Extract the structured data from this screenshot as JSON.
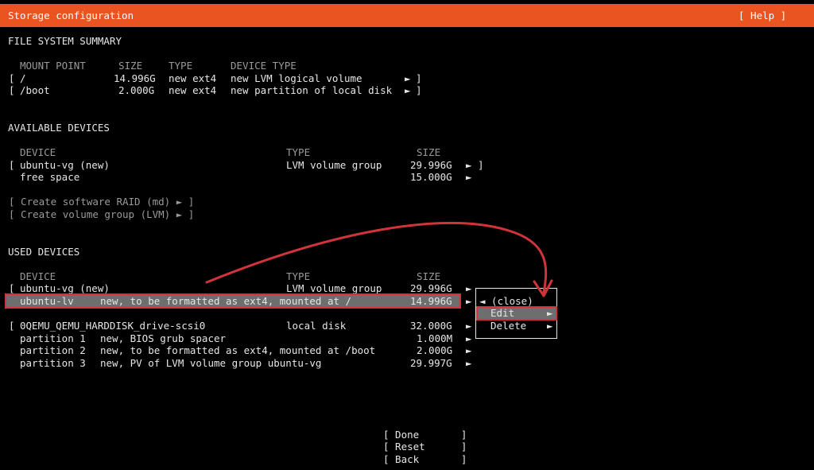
{
  "header": {
    "title": "Storage configuration",
    "help": "[ Help ]"
  },
  "fs_summary": {
    "heading": "FILE SYSTEM SUMMARY",
    "columns": {
      "mount_point": "MOUNT POINT",
      "size": "SIZE",
      "type": "TYPE",
      "device_type": "DEVICE TYPE"
    },
    "rows": [
      {
        "open": "[",
        "mount": "/",
        "size": "14.996G",
        "type": "new ext4",
        "device_type": "new LVM logical volume",
        "arrow": "►",
        "close": "]"
      },
      {
        "open": "[",
        "mount": "/boot",
        "size": "2.000G",
        "type": "new ext4",
        "device_type": "new partition of local disk",
        "arrow": "►",
        "close": "]"
      }
    ]
  },
  "available": {
    "heading": "AVAILABLE DEVICES",
    "columns": {
      "device": "DEVICE",
      "type": "TYPE",
      "size": "SIZE"
    },
    "rows": [
      {
        "open": "[",
        "device": "ubuntu-vg (new)",
        "type": "LVM volume group",
        "size": "29.996G",
        "arrow": "►",
        "close": "]"
      },
      {
        "open": "",
        "device": "free space",
        "type": "",
        "size": "15.000G",
        "arrow": "►",
        "close": ""
      }
    ],
    "actions": [
      "[ Create software RAID (md) ► ]",
      "[ Create volume group (LVM) ► ]"
    ]
  },
  "used": {
    "heading": "USED DEVICES",
    "columns": {
      "device": "DEVICE",
      "type": "TYPE",
      "size": "SIZE"
    },
    "vg": {
      "open": "[",
      "device": "ubuntu-vg (new)",
      "type": "LVM volume group",
      "size": "29.996G",
      "arrow": "►"
    },
    "lv": {
      "device": "ubuntu-lv",
      "desc": "new, to be formatted as ext4, mounted at /",
      "size": "14.996G",
      "arrow": "►"
    },
    "disk": {
      "open": "[",
      "device": "0QEMU_QEMU_HARDDISK_drive-scsi0",
      "type": "local disk",
      "size": "32.000G",
      "arrow": "►"
    },
    "partitions": [
      {
        "label": "partition 1",
        "desc": "new, BIOS grub spacer",
        "size": "1.000M",
        "arrow": "►"
      },
      {
        "label": "partition 2",
        "desc": "new, to be formatted as ext4, mounted at /boot",
        "size": "2.000G",
        "arrow": "►"
      },
      {
        "label": "partition 3",
        "desc": "new, PV of LVM volume group ubuntu-vg",
        "size": "29.997G",
        "arrow": "►"
      }
    ]
  },
  "popup": {
    "close": "◄ (close)",
    "edit": "Edit",
    "edit_arrow": "►",
    "delete": "Delete",
    "delete_arrow": "►"
  },
  "footer": {
    "done": "[ Done       ]",
    "reset": "[ Reset      ]",
    "back": "[ Back       ]"
  },
  "colors": {
    "accent": "#e95420",
    "selection": "#6e6e6e",
    "annotation": "#d0343a"
  }
}
